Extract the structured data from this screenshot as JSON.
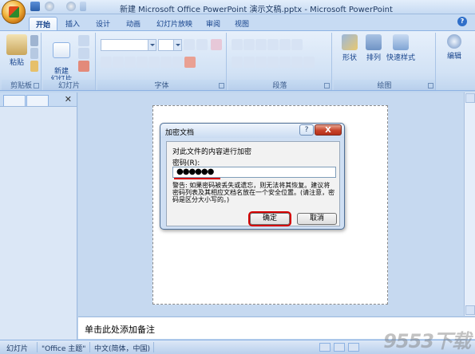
{
  "window": {
    "title": "新建 Microsoft Office PowerPoint 演示文稿.pptx - Microsoft PowerPoint"
  },
  "tabs": [
    "开始",
    "插入",
    "设计",
    "动画",
    "幻灯片放映",
    "审阅",
    "视图"
  ],
  "active_tab": "开始",
  "ribbon": {
    "groups": {
      "clipboard": {
        "label": "剪贴板",
        "paste": "粘贴"
      },
      "slides": {
        "label": "幻灯片",
        "new_slide": "新建\n幻灯片"
      },
      "font": {
        "label": "字体"
      },
      "paragraph": {
        "label": "段落"
      },
      "drawing": {
        "label": "绘图",
        "shapes": "形状",
        "arrange": "排列",
        "quick_styles": "快速样式"
      },
      "editing": {
        "label": "编辑"
      }
    }
  },
  "notes": {
    "placeholder": "单击此处添加备注"
  },
  "statusbar": {
    "slide": "幻灯片",
    "theme": "\"Office 主题\"",
    "language": "中文(简体，中国)"
  },
  "watermark": "9553下载",
  "dialog": {
    "title": "加密文档",
    "help": "?",
    "close": "X",
    "description": "对此文件的内容进行加密",
    "password_label": "密码(R):",
    "password_value": "●●●●●●",
    "warning": "警告: 如果密码被丢失或遗忘，则无法将其恢复。建议将密码列表及其相应文档名放在一个安全位置。(请注意，密码是区分大小写的。)",
    "ok": "确定",
    "cancel": "取消"
  },
  "colors": {
    "ribbon": "#d2e2f5",
    "accent_red": "#d40000",
    "title_text": "#15428b"
  }
}
